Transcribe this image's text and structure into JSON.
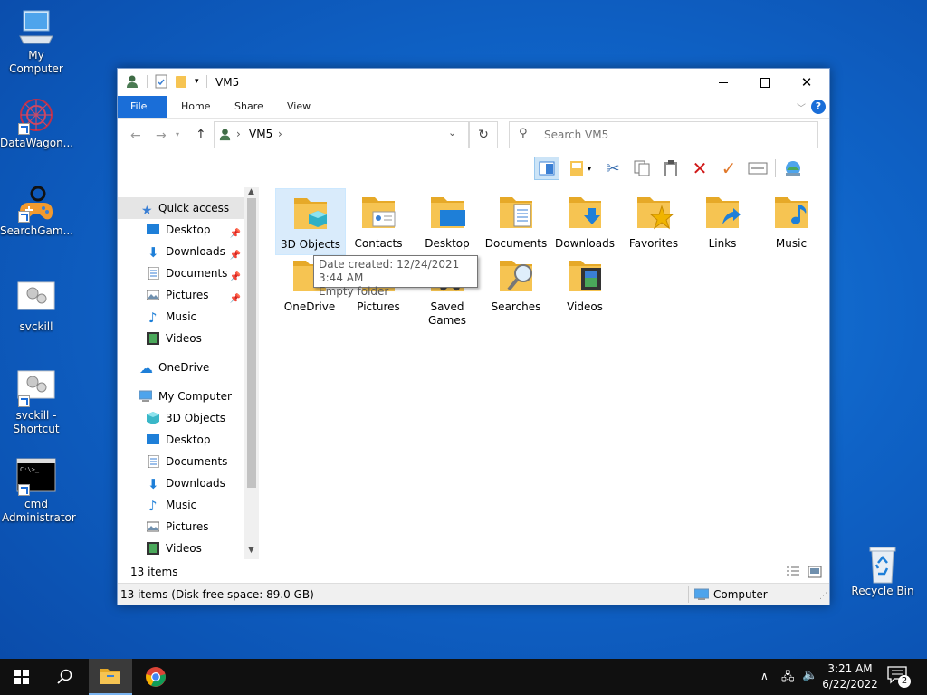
{
  "desktop": {
    "icons": [
      {
        "label": "My Computer"
      },
      {
        "label": "DataWagon..."
      },
      {
        "label": "SearchGam..."
      },
      {
        "label": "svckill"
      },
      {
        "label": "svckill - Shortcut"
      },
      {
        "label": "cmd Administrator"
      },
      {
        "label": "Recycle Bin"
      }
    ]
  },
  "window": {
    "title": "VM5",
    "ribbon_tabs": [
      "File",
      "Home",
      "Share",
      "View"
    ],
    "help_label": "?",
    "address": {
      "path": [
        "VM5"
      ]
    },
    "search": {
      "placeholder": "Search VM5"
    },
    "nav": {
      "quick_access": "Quick access",
      "quick_items": [
        "Desktop",
        "Downloads",
        "Documents",
        "Pictures",
        "Music",
        "Videos"
      ],
      "onedrive": "OneDrive",
      "my_computer": "My Computer",
      "computer_items": [
        "3D Objects",
        "Desktop",
        "Documents",
        "Downloads",
        "Music",
        "Pictures",
        "Videos"
      ]
    },
    "folders": [
      "3D Objects",
      "Contacts",
      "Desktop",
      "Documents",
      "Downloads",
      "Favorites",
      "Links",
      "Music",
      "OneDrive",
      "Pictures",
      "Saved Games",
      "Searches",
      "Videos"
    ],
    "tooltip": {
      "line1": "Date created: 12/24/2021 3:44 AM",
      "line2": "Empty folder"
    },
    "item_count": "13 items",
    "status_text": "13 items (Disk free space: 89.0 GB)",
    "status_location": "Computer"
  },
  "taskbar": {
    "time": "3:21 AM",
    "date": "6/22/2022",
    "notification_count": "2"
  },
  "colors": {
    "accent": "#1a6ed8",
    "folder": "#f6c452",
    "selection": "#d9ebfb"
  }
}
